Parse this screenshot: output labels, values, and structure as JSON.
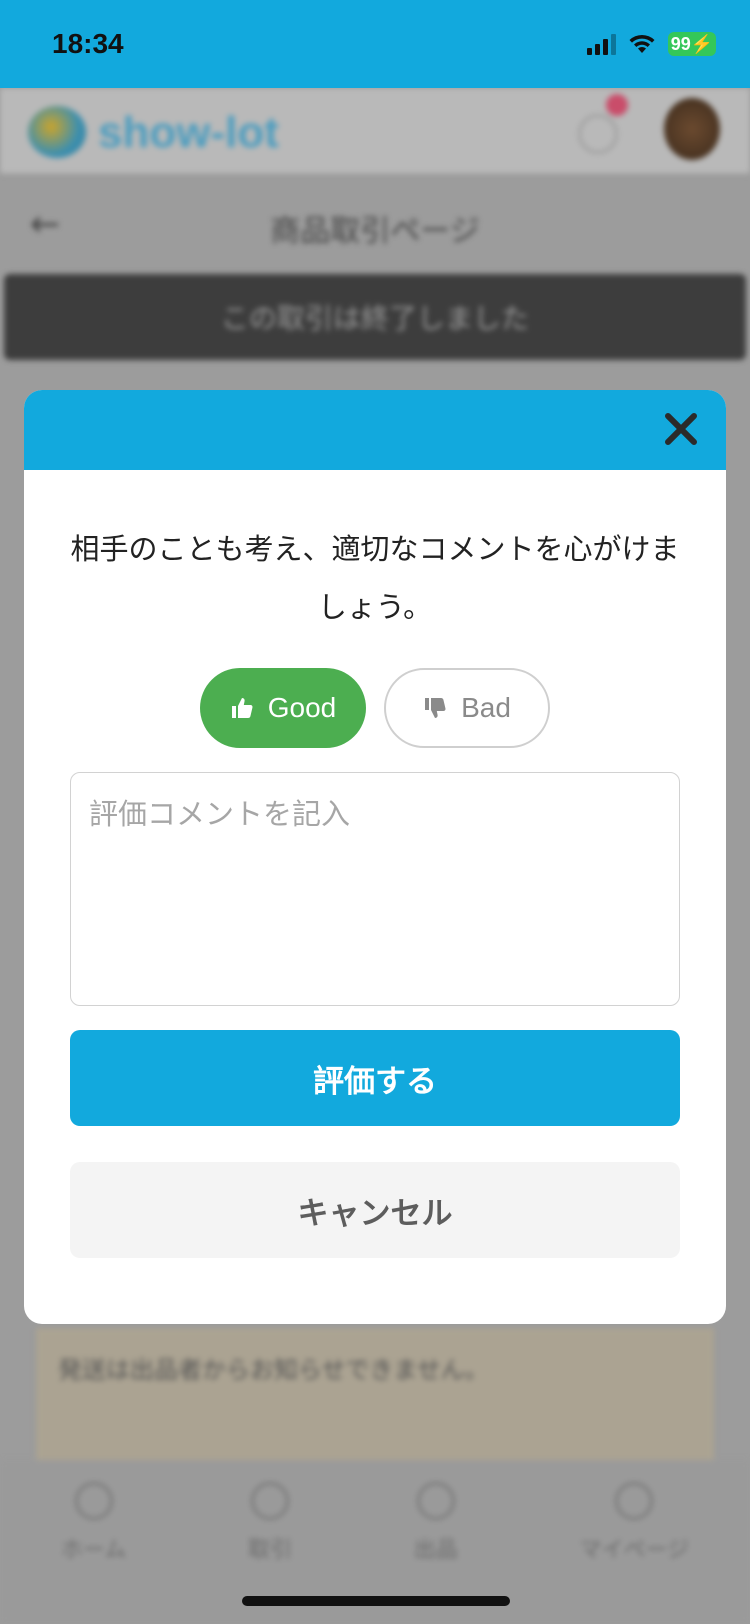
{
  "status_bar": {
    "time": "18:34",
    "battery": "99"
  },
  "background": {
    "app_name": "show-lot",
    "page_title": "商品取引ページ",
    "banner": "この取引は終了しました",
    "notice": "発送は出品者からお知らせできません。",
    "tabs": [
      "ホーム",
      "取引",
      "出品",
      "マイページ"
    ]
  },
  "modal": {
    "guideline": "相手のことも考え、適切なコメントを心がけましょう。",
    "good_label": "Good",
    "bad_label": "Bad",
    "selected_rating": "Good",
    "comment_value": "",
    "comment_placeholder": "評価コメントを記入",
    "submit_label": "評価する",
    "cancel_label": "キャンセル"
  },
  "colors": {
    "accent": "#12a9dd",
    "good": "#4cae50",
    "cancel_bg": "#f4f4f4"
  }
}
